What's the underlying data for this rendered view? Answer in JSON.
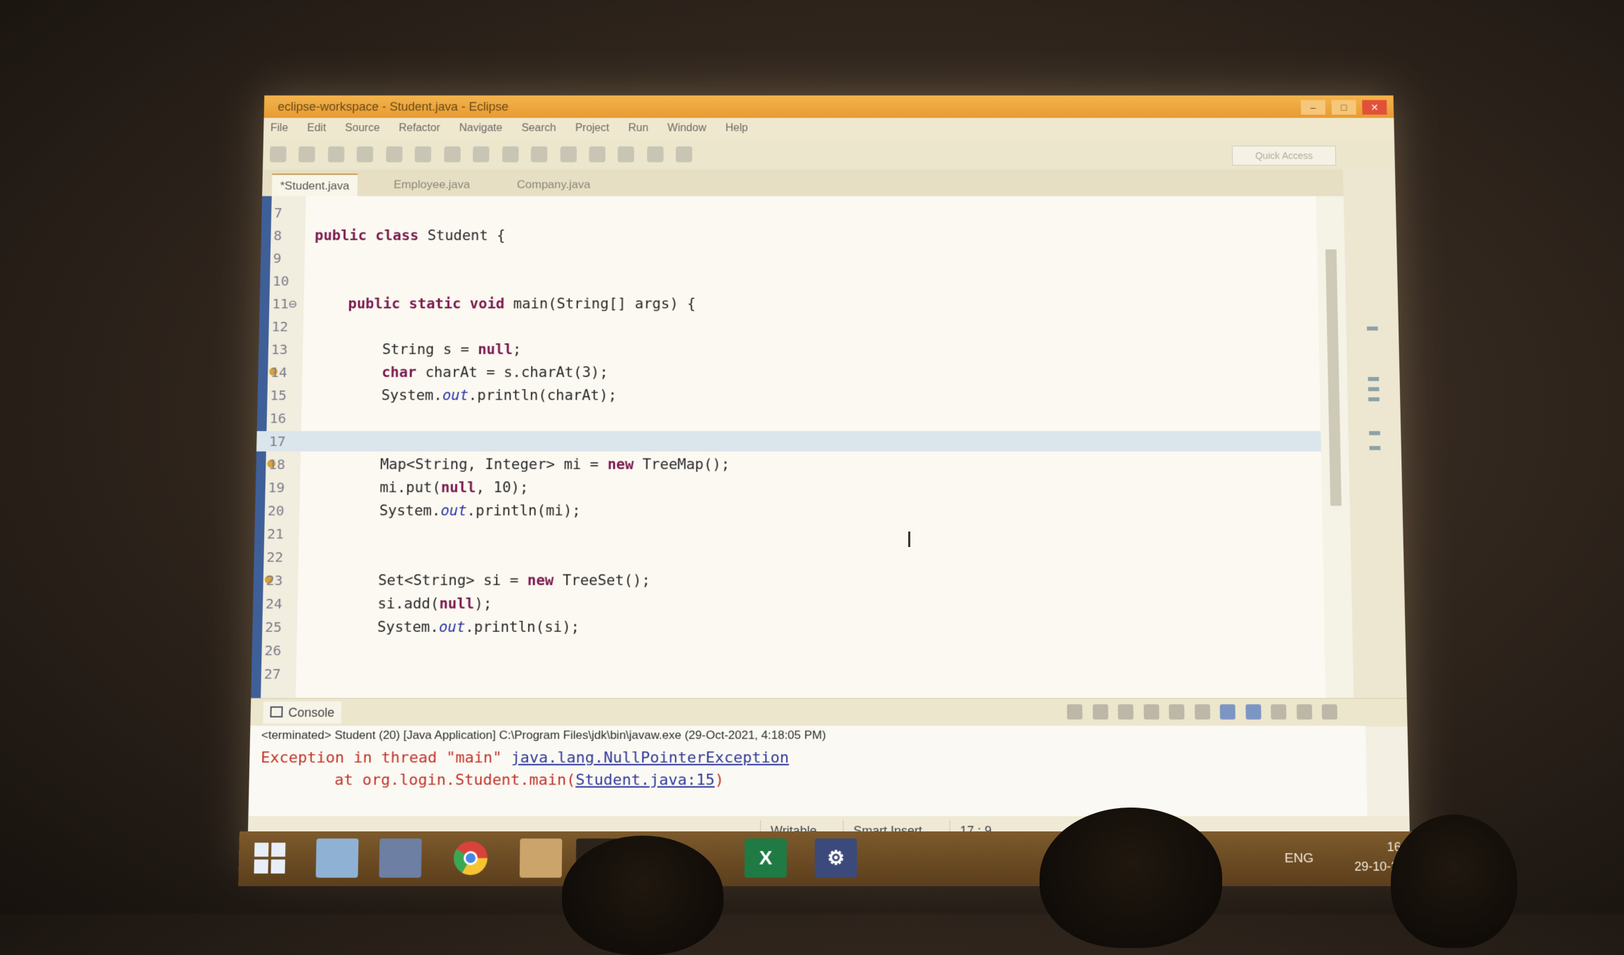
{
  "window": {
    "title": "eclipse-workspace - Student.java - Eclipse"
  },
  "menu": [
    "File",
    "Edit",
    "Source",
    "Refactor",
    "Navigate",
    "Search",
    "Project",
    "Run",
    "Window",
    "Help"
  ],
  "toolbar": {
    "quick_access": "Quick Access"
  },
  "tabs": [
    {
      "label": "*Student.java",
      "active": true
    },
    {
      "label": "Employee.java",
      "active": false
    },
    {
      "label": "Company.java",
      "active": false
    }
  ],
  "editor": {
    "lines": [
      {
        "num": "7",
        "code": ""
      },
      {
        "num": "8",
        "code": "public class Student {"
      },
      {
        "num": "9",
        "code": ""
      },
      {
        "num": "10",
        "code": ""
      },
      {
        "num": "11⊖",
        "code": "    public static void main(String[] args) {"
      },
      {
        "num": "12",
        "code": ""
      },
      {
        "num": "13",
        "code": "        String s = null;"
      },
      {
        "num": "14",
        "code": "        char charAt = s.charAt(3);",
        "marker": true
      },
      {
        "num": "15",
        "code": "        System.out.println(charAt);"
      },
      {
        "num": "16",
        "code": ""
      },
      {
        "num": "17",
        "code": "",
        "current": true
      },
      {
        "num": "18",
        "code": "        Map<String, Integer> mi = new TreeMap();",
        "marker": true
      },
      {
        "num": "19",
        "code": "        mi.put(null, 10);"
      },
      {
        "num": "20",
        "code": "        System.out.println(mi);"
      },
      {
        "num": "21",
        "code": ""
      },
      {
        "num": "22",
        "code": ""
      },
      {
        "num": "23",
        "code": "        Set<String> si = new TreeSet();",
        "marker": true
      },
      {
        "num": "24",
        "code": "        si.add(null);"
      },
      {
        "num": "25",
        "code": "        System.out.println(si);"
      },
      {
        "num": "26",
        "code": ""
      },
      {
        "num": "27",
        "code": ""
      }
    ]
  },
  "console": {
    "tab_label": "Console",
    "header": "<terminated> Student (20) [Java Application] C:\\Program Files\\jdk\\bin\\javaw.exe (29-Oct-2021, 4:18:05 PM)",
    "line1_prefix": "Exception in thread \"main\" ",
    "line1_link": "java.lang.NullPointerException",
    "line2_prefix": "        at org.login.Student.main(",
    "line2_link": "Student.java:15",
    "line2_suffix": ")"
  },
  "status_bar": {
    "writable": "Writable",
    "insert_mode": "Smart Insert",
    "position": "17 : 9"
  },
  "taskbar": {
    "language": "ENG",
    "time": "16:20",
    "date": "29-10-2021",
    "excel_label": "X"
  },
  "colors": {
    "title_bar": "#e79b32",
    "editor_bg": "#fbf9f1",
    "keyword": "#7a1a4f",
    "error_text": "#c2332a",
    "link": "#2f3a9a"
  }
}
